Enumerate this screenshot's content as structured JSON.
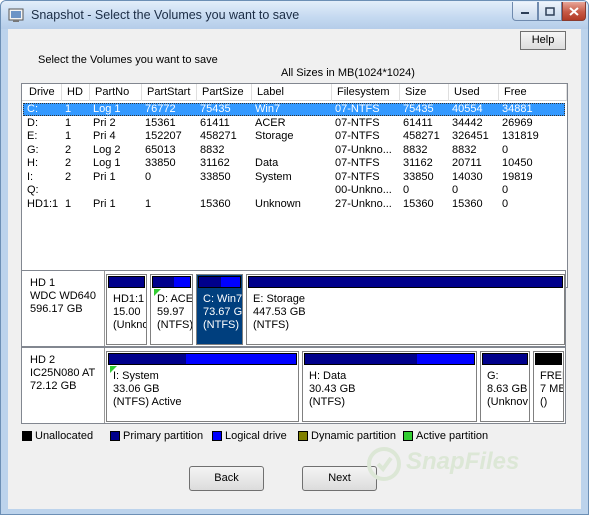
{
  "window": {
    "title": "Snapshot - Select the Volumes you want to save",
    "controls": {
      "minimize_icon": "minimize-icon",
      "maximize_icon": "maximize-icon",
      "close_icon": "close-icon"
    }
  },
  "header": {
    "help_label": "Help",
    "instruction": "Select the Volumes you want to save",
    "sizes_note": "All Sizes in MB(1024*1024)"
  },
  "volume_table": {
    "columns": [
      "Drive",
      "HD",
      "PartNo",
      "PartStart",
      "PartSize",
      "Label",
      "Filesystem",
      "Size",
      "Used",
      "Free"
    ],
    "rows": [
      {
        "drive": "C:",
        "hd": "1",
        "partno": "Log 1",
        "partstart": "76772",
        "partsize": "75435",
        "label": "Win7",
        "filesystem": "07-NTFS",
        "size": "75435",
        "used": "40554",
        "free": "34881",
        "selected": true
      },
      {
        "drive": "D:",
        "hd": "1",
        "partno": "Pri 2",
        "partstart": "15361",
        "partsize": "61411",
        "label": "ACER",
        "filesystem": "07-NTFS",
        "size": "61411",
        "used": "34442",
        "free": "26969",
        "selected": false
      },
      {
        "drive": "E:",
        "hd": "1",
        "partno": "Pri 4",
        "partstart": "152207",
        "partsize": "458271",
        "label": "Storage",
        "filesystem": "07-NTFS",
        "size": "458271",
        "used": "326451",
        "free": "131819",
        "selected": false
      },
      {
        "drive": "G:",
        "hd": "2",
        "partno": "Log 2",
        "partstart": "65013",
        "partsize": "8832",
        "label": "",
        "filesystem": "07-Unkno...",
        "size": "8832",
        "used": "8832",
        "free": "0",
        "selected": false
      },
      {
        "drive": "H:",
        "hd": "2",
        "partno": "Log 1",
        "partstart": "33850",
        "partsize": "31162",
        "label": "Data",
        "filesystem": "07-NTFS",
        "size": "31162",
        "used": "20711",
        "free": "10450",
        "selected": false
      },
      {
        "drive": "I:",
        "hd": "2",
        "partno": "Pri 1",
        "partstart": "0",
        "partsize": "33850",
        "label": "System",
        "filesystem": "07-NTFS",
        "size": "33850",
        "used": "14030",
        "free": "19819",
        "selected": false
      },
      {
        "drive": "Q:",
        "hd": "",
        "partno": "",
        "partstart": "",
        "partsize": "",
        "label": "",
        "filesystem": "00-Unkno...",
        "size": "0",
        "used": "0",
        "free": "0",
        "selected": false
      },
      {
        "drive": "HD1:1",
        "hd": "1",
        "partno": "Pri 1",
        "partstart": "1",
        "partsize": "15360",
        "label": "Unknown",
        "filesystem": "27-Unkno...",
        "size": "15360",
        "used": "15360",
        "free": "0",
        "selected": false
      }
    ]
  },
  "disks": [
    {
      "name": "HD 1",
      "model": "WDC WD640",
      "capacity": "596.17 GB",
      "partitions": [
        {
          "lines": [
            "HD1:1",
            "15.00",
            "(Unkno"
          ],
          "used_fraction": 1.0,
          "active": false,
          "selected": false
        },
        {
          "lines": [
            "D: ACE",
            "59.97",
            "(NTFS)"
          ],
          "used_fraction": 0.56,
          "active": true,
          "selected": false
        },
        {
          "lines": [
            "C: Win7",
            "73.67 GI",
            "(NTFS)"
          ],
          "used_fraction": 0.54,
          "active": false,
          "selected": true
        },
        {
          "lines": [
            "E: Storage",
            "447.53 GB",
            "(NTFS)"
          ],
          "used_fraction": 1.0,
          "active": false,
          "selected": false
        }
      ]
    },
    {
      "name": "HD 2",
      "model": "IC25N080 AT",
      "capacity": "72.12 GB",
      "partitions": [
        {
          "lines": [
            "I: System",
            "33.06 GB",
            "(NTFS) Active"
          ],
          "used_fraction": 0.41,
          "active": true,
          "selected": false
        },
        {
          "lines": [
            "H: Data",
            "30.43 GB",
            "(NTFS)"
          ],
          "used_fraction": 0.66,
          "active": false,
          "selected": false
        },
        {
          "lines": [
            "G:",
            "8.63 GB",
            "(Unknov"
          ],
          "used_fraction": 1.0,
          "active": false,
          "selected": false
        },
        {
          "lines": [
            "FREE",
            "7 MB",
            "()"
          ],
          "used_fraction": 1.0,
          "active": false,
          "selected": false,
          "unallocated": true
        }
      ]
    }
  ],
  "legend": [
    {
      "label": "Unallocated",
      "color": "#000000"
    },
    {
      "label": "Primary partition",
      "color": "#00008b"
    },
    {
      "label": "Logical drive",
      "color": "#0000ff"
    },
    {
      "label": "Dynamic partition",
      "color": "#808000"
    },
    {
      "label": "Active partition",
      "color": "#32cd32"
    }
  ],
  "footer": {
    "back_label": "Back",
    "next_label": "Next"
  },
  "watermark": {
    "text": "SnapFiles",
    "icon": "snapfiles-logo-icon"
  }
}
